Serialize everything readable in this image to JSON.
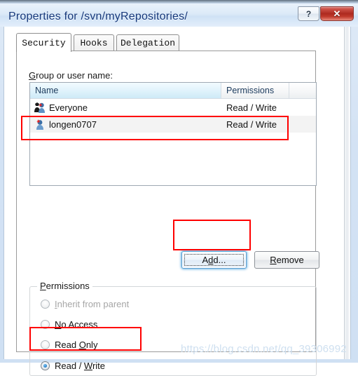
{
  "window": {
    "title": "Properties for /svn/myRepositories/",
    "help_button": "?",
    "close_button": "✕",
    "accent_blue": "#15387b",
    "close_red": "#ad2a20"
  },
  "tabs": [
    {
      "label": "Security",
      "active": true
    },
    {
      "label": "Hooks",
      "active": false
    },
    {
      "label": "Delegation",
      "active": false
    }
  ],
  "security_tab": {
    "group_label_prefix": "G",
    "group_label_rest": "roup or user name:",
    "list": {
      "columns": [
        {
          "key": "name",
          "label": "Name",
          "sorted": true
        },
        {
          "key": "permissions",
          "label": "Permissions",
          "sorted": false
        },
        {
          "key": "extra",
          "label": "",
          "sorted": false
        }
      ],
      "rows": [
        {
          "name": "Everyone",
          "permissions": "Read / Write",
          "icon": "group-users-icon",
          "selected": false
        },
        {
          "name": "longen0707",
          "permissions": "Read / Write",
          "icon": "single-user-icon",
          "selected": true
        }
      ]
    },
    "buttons": {
      "add": {
        "prefix": "A",
        "mnemonic": "d",
        "suffix": "d...",
        "focused": true
      },
      "remove": {
        "prefix": "",
        "mnemonic": "R",
        "suffix": "emove",
        "focused": false
      }
    },
    "permissions_group": {
      "legend_mnemonic": "P",
      "legend_rest": "ermissions",
      "options": [
        {
          "before": "",
          "mnemonic": "I",
          "after": "nherit from parent",
          "checked": false,
          "disabled": true
        },
        {
          "before": "",
          "mnemonic": "N",
          "after": "o Access",
          "checked": false,
          "disabled": false
        },
        {
          "before": "Read ",
          "mnemonic": "O",
          "after": "nly",
          "checked": false,
          "disabled": false
        },
        {
          "before": "Read / ",
          "mnemonic": "W",
          "after": "rite",
          "checked": true,
          "disabled": false
        }
      ]
    }
  },
  "annotations": {
    "color": "#ff0000",
    "boxes": [
      {
        "name": "user-row-highlight",
        "target": "longen0707 list row"
      },
      {
        "name": "add-button-highlight",
        "target": "Add... button"
      },
      {
        "name": "read-write-highlight",
        "target": "Read / Write radio"
      }
    ]
  },
  "watermark": {
    "text": "https://blog.csdn.net/qq_39306992"
  }
}
